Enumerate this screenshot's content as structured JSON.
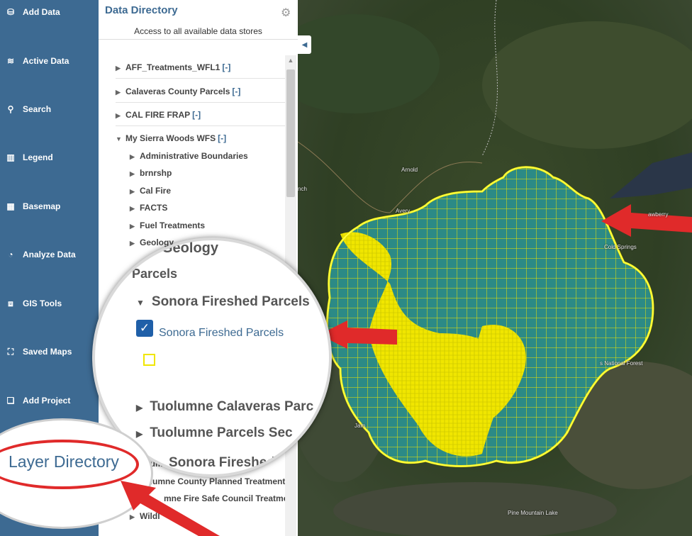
{
  "nav": {
    "items": [
      {
        "label": "Add Data",
        "icon": "add-data-icon"
      },
      {
        "label": "Active Data",
        "icon": "layers-icon"
      },
      {
        "label": "Search",
        "icon": "search-icon"
      },
      {
        "label": "Legend",
        "icon": "map-icon"
      },
      {
        "label": "Basemap",
        "icon": "grid-icon"
      },
      {
        "label": "Analyze Data",
        "icon": "pie-chart-icon"
      },
      {
        "label": "GIS Tools",
        "icon": "toolbox-icon"
      },
      {
        "label": "Saved Maps",
        "icon": "saved-maps-icon"
      },
      {
        "label": "Add Project",
        "icon": "add-project-icon"
      }
    ]
  },
  "panel": {
    "title": "Data Directory",
    "subtitle": "Access to all available data stores",
    "toggle": "[-]",
    "stores": [
      {
        "label": "AFF_Treatments_WFL1"
      },
      {
        "label": "Calaveras County Parcels"
      },
      {
        "label": "CAL FIRE FRAP"
      },
      {
        "label": "My Sierra Woods WFS"
      }
    ],
    "children": [
      "Administrative Boundaries",
      "brnrshp",
      "Cal Fire",
      "FACTS",
      "Fuel Treatments",
      "Geology"
    ],
    "lower_items": [
      "olumne County Parcels",
      "uolumne County Planned Treatment",
      "mne Fire Safe Council Treatmen",
      "Wildl"
    ]
  },
  "magnifier": {
    "geology": "Geology",
    "parcels": "Parcels",
    "group": "Sonora Fireshed Parcels",
    "layer": "Sonora Fireshed Parcels",
    "item1": "Tuolumne Calaveras Parc",
    "item2": "Tuolumne Parcels Sec",
    "item3": "Sonora Fireshed Ma"
  },
  "callout": {
    "layer_directory": "Layer Directory"
  },
  "map": {
    "labels": [
      "Arnold",
      "Avery",
      "nch",
      "awberry",
      "Cold Springs",
      "Pine Mountain Lake",
      "s National Forest",
      "Jam"
    ]
  },
  "colors": {
    "nav_bg": "#3d6a92",
    "accent": "#3d6a92",
    "parcel_outline": "#f0e600",
    "annotation_red": "#e02a2a"
  }
}
